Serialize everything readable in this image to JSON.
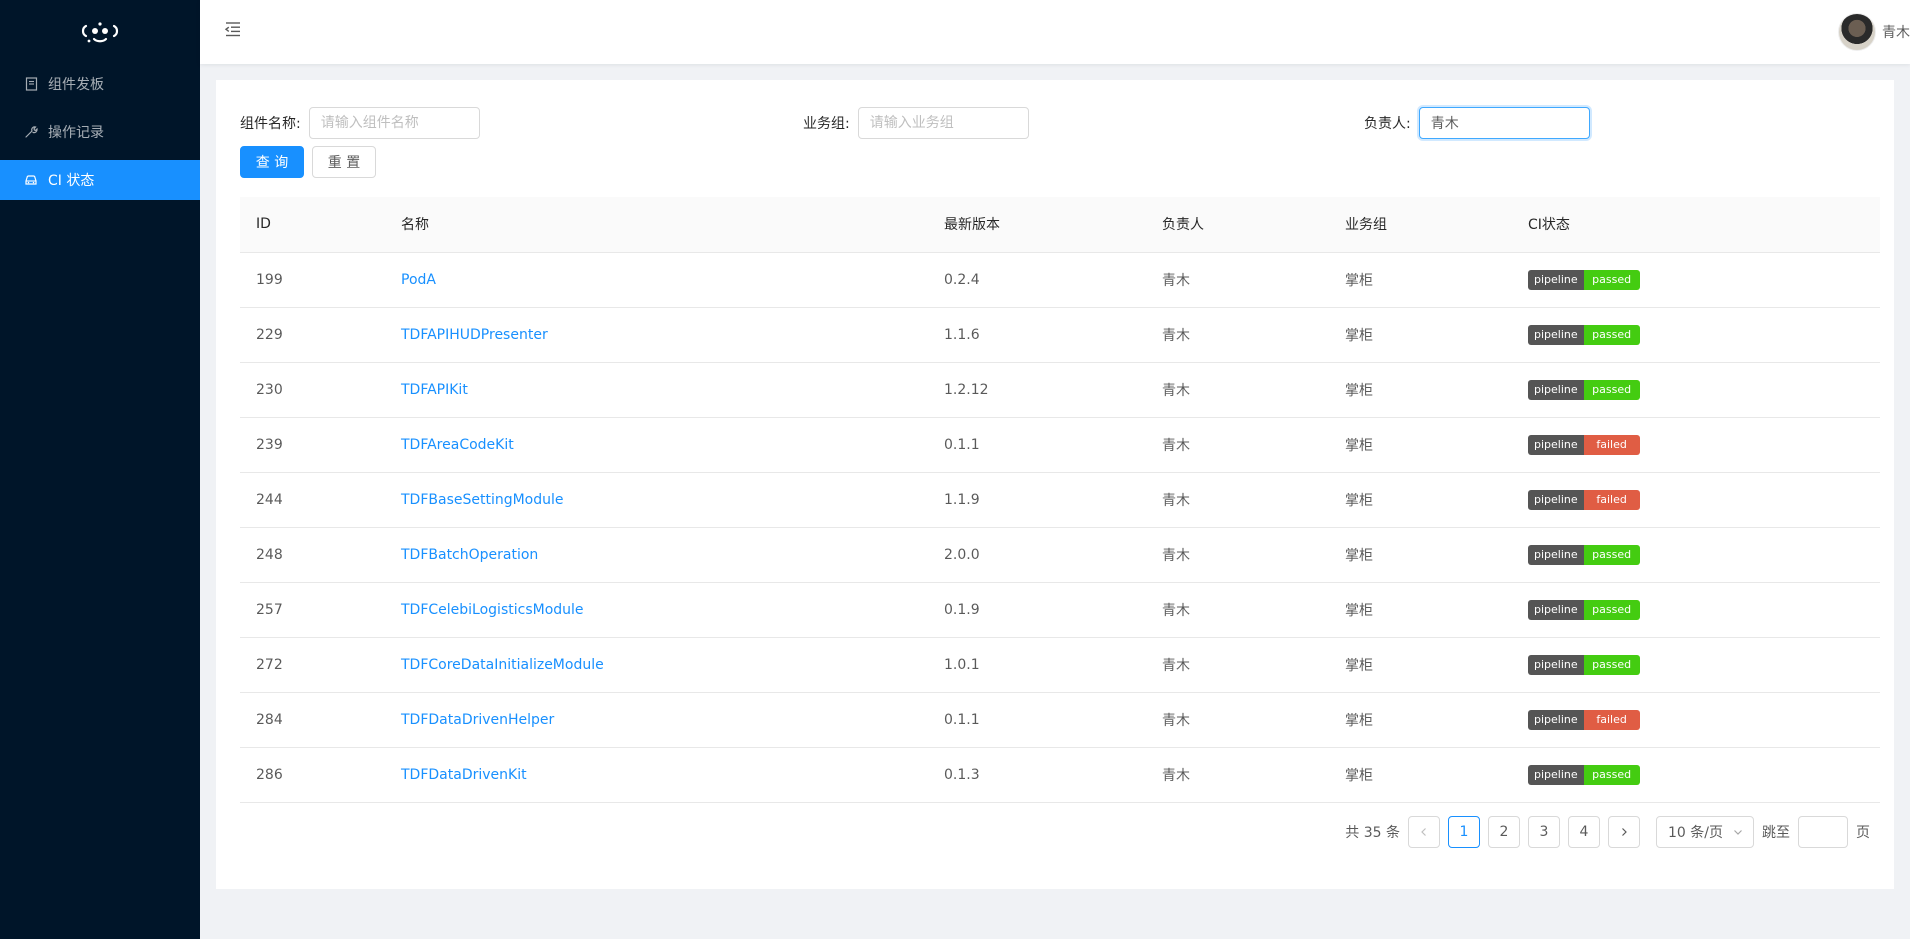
{
  "sidebar": {
    "items": [
      {
        "label": "组件发板",
        "icon": "book-icon"
      },
      {
        "label": "操作记录",
        "icon": "wrench-icon"
      },
      {
        "label": "CI 状态",
        "icon": "car-icon",
        "active": true
      }
    ]
  },
  "header": {
    "username": "青木"
  },
  "search": {
    "component_label": "组件名称:",
    "component_placeholder": "请输入组件名称",
    "component_value": "",
    "group_label": "业务组:",
    "group_placeholder": "请输入业务组",
    "group_value": "",
    "owner_label": "负责人:",
    "owner_value": "青木",
    "query_button": "查 询",
    "reset_button": "重 置"
  },
  "table": {
    "columns": [
      "ID",
      "名称",
      "最新版本",
      "负责人",
      "业务组",
      "CI状态"
    ],
    "badge_label": "pipeline",
    "rows": [
      {
        "id": "199",
        "name": "PodA",
        "version": "0.2.4",
        "owner": "青木",
        "group": "掌柜",
        "status": "passed"
      },
      {
        "id": "229",
        "name": "TDFAPIHUDPresenter",
        "version": "1.1.6",
        "owner": "青木",
        "group": "掌柜",
        "status": "passed"
      },
      {
        "id": "230",
        "name": "TDFAPIKit",
        "version": "1.2.12",
        "owner": "青木",
        "group": "掌柜",
        "status": "passed"
      },
      {
        "id": "239",
        "name": "TDFAreaCodeKit",
        "version": "0.1.1",
        "owner": "青木",
        "group": "掌柜",
        "status": "failed"
      },
      {
        "id": "244",
        "name": "TDFBaseSettingModule",
        "version": "1.1.9",
        "owner": "青木",
        "group": "掌柜",
        "status": "failed"
      },
      {
        "id": "248",
        "name": "TDFBatchOperation",
        "version": "2.0.0",
        "owner": "青木",
        "group": "掌柜",
        "status": "passed"
      },
      {
        "id": "257",
        "name": "TDFCelebiLogisticsModule",
        "version": "0.1.9",
        "owner": "青木",
        "group": "掌柜",
        "status": "passed"
      },
      {
        "id": "272",
        "name": "TDFCoreDataInitializeModule",
        "version": "1.0.1",
        "owner": "青木",
        "group": "掌柜",
        "status": "passed"
      },
      {
        "id": "284",
        "name": "TDFDataDrivenHelper",
        "version": "0.1.1",
        "owner": "青木",
        "group": "掌柜",
        "status": "failed"
      },
      {
        "id": "286",
        "name": "TDFDataDrivenKit",
        "version": "0.1.3",
        "owner": "青木",
        "group": "掌柜",
        "status": "passed"
      }
    ]
  },
  "pagination": {
    "total": "共 35 条",
    "pages": [
      "1",
      "2",
      "3",
      "4"
    ],
    "current": "1",
    "page_size": "10 条/页",
    "jump_label": "跳至",
    "page_suffix": "页"
  },
  "colors": {
    "primary": "#1890ff",
    "sider": "#001529",
    "passed": "#44cc11",
    "failed": "#e05d44"
  }
}
